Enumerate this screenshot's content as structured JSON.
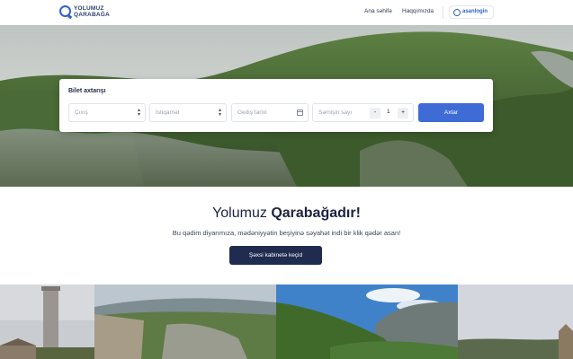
{
  "header": {
    "logo_line1": "YOLUMUZ",
    "logo_line2": "QARABAĞA",
    "logo_icon": "q-logo-icon",
    "nav": [
      {
        "label": "Ana səhifə"
      },
      {
        "label": "Haqqımızda"
      }
    ],
    "login": {
      "label": "asanlogin",
      "icon": "asan-icon"
    }
  },
  "search": {
    "title": "Bilet axtarışı",
    "from_placeholder": "Çıxış",
    "to_placeholder": "İstiqamət",
    "date_placeholder": "Gediş tarixi",
    "passengers_label": "Sərnişin sayı",
    "passengers_value": "1",
    "minus": "-",
    "plus": "+",
    "button": "Axtar"
  },
  "welcome": {
    "title_plain": "Yolumuz ",
    "title_bold": "Qarabağadır!",
    "subtitle": "Bu qədim diyarımıza, mədəniyyətin beşiyinə səyahət indi bir klik qədər asan!",
    "button": "Şəxsi kabinetə keçid"
  },
  "colors": {
    "accent": "#3e6bd6",
    "dark_button": "#1f2b4f",
    "brand": "#2f63c8"
  }
}
